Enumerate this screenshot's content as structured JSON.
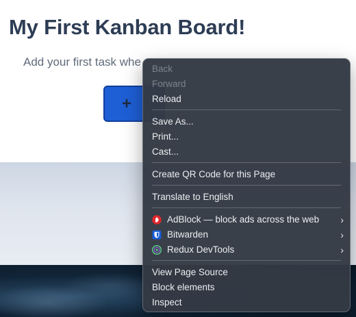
{
  "page": {
    "title": "My First Kanban Board!",
    "subtitle": "Add your first task whe",
    "add_button_symbol": "+"
  },
  "context_menu": {
    "nav": [
      {
        "label": "Back",
        "enabled": false
      },
      {
        "label": "Forward",
        "enabled": false
      },
      {
        "label": "Reload",
        "enabled": true
      }
    ],
    "file": [
      {
        "label": "Save As..."
      },
      {
        "label": "Print..."
      },
      {
        "label": "Cast..."
      }
    ],
    "qr": {
      "label": "Create QR Code for this Page"
    },
    "translate": {
      "label": "Translate to English"
    },
    "extensions": [
      {
        "label": "AdBlock — block ads across the web",
        "icon": "adblock-icon",
        "color": "#e0262b"
      },
      {
        "label": "Bitwarden",
        "icon": "bitwarden-shield-icon",
        "color": "#175ddc"
      },
      {
        "label": "Redux DevTools",
        "icon": "redux-devtools-icon",
        "color": "#5bd38a"
      }
    ],
    "developer": [
      {
        "label": "View Page Source"
      },
      {
        "label": "Block elements"
      },
      {
        "label": "Inspect"
      }
    ],
    "submenu_glyph": "›"
  }
}
